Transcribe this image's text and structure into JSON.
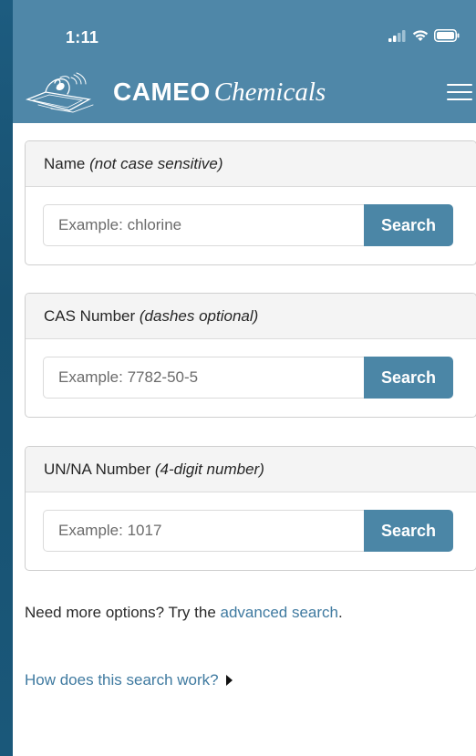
{
  "status_bar": {
    "time": "1:11",
    "icons": [
      "signal-icon",
      "wifi-icon",
      "battery-icon"
    ]
  },
  "header": {
    "brand_bold": "CAMEO",
    "brand_italic": "Chemicals",
    "logo_icon": "cameo-logo-icon",
    "menu_icon": "hamburger-menu-icon",
    "background_color": "#4f87a8"
  },
  "panels": [
    {
      "label": "Name",
      "hint": "(not case sensitive)",
      "placeholder": "Example: chlorine",
      "button_label": "Search"
    },
    {
      "label": "CAS Number",
      "hint": "(dashes optional)",
      "placeholder": "Example: 7782-50-5",
      "button_label": "Search"
    },
    {
      "label": "UN/NA Number",
      "hint": "(4-digit number)",
      "placeholder": "Example: 1017",
      "button_label": "Search"
    }
  ],
  "more_options": {
    "prefix": "Need more options? Try the",
    "link_text": "advanced search",
    "suffix": "."
  },
  "help": {
    "link_text": "How does this search work?",
    "icon": "caret-right-icon"
  },
  "colors": {
    "accent": "#4b86a6",
    "link": "#3f7aa0"
  }
}
